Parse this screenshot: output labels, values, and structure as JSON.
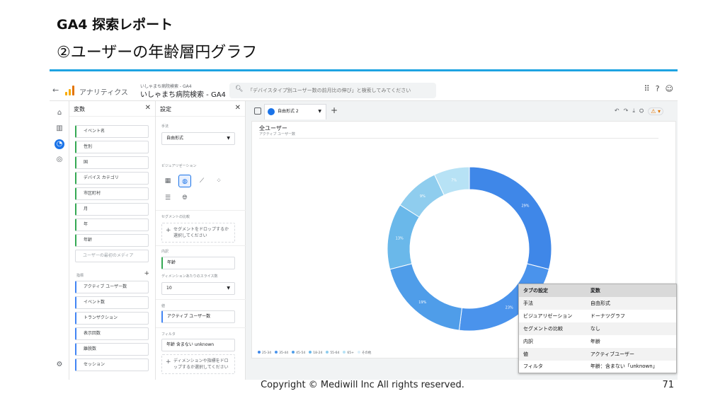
{
  "slide": {
    "title": "GA4 探索レポート",
    "subtitle": "②ユーザーの年齢層円グラフ",
    "footer": "Copyright © Mediwill Inc All rights reserved.",
    "page_number": "71"
  },
  "app": {
    "name": "アナリティクス",
    "account_small": "いしゃまち病院検索 - GA4",
    "account": "いしゃまち病院検索 - GA4",
    "search_placeholder": "「デバイスタイプ別ユーザー数の前月比の伸び」と検索してみてください"
  },
  "variables_panel": {
    "title": "変数",
    "dimensions": [
      "イベント名",
      "性別",
      "国",
      "デバイス カテゴリ",
      "市区町村",
      "月",
      "年",
      "年齢",
      "ユーザーの最初のメディア"
    ],
    "metrics_label": "指標",
    "metrics": [
      "アクティブ ユーザー数",
      "イベント数",
      "トランザクション",
      "表示回数",
      "離脱数",
      "セッション"
    ]
  },
  "settings_panel": {
    "title": "設定",
    "technique_label": "手法",
    "technique_value": "自由形式",
    "visualization_label": "ビジュアリゼーション",
    "segment_label": "セグメントの比較",
    "segment_drop": "セグメントをドロップするか選択してください",
    "breakdown_label": "内訳",
    "breakdown_value": "年齢",
    "rows_label": "ディメンションあたりのスライス数",
    "rows_value": "10",
    "values_label": "値",
    "values_value": "アクティブ ユーザー数",
    "filter_label": "フィルタ",
    "filter_value": "年齢 含まない unknown",
    "filter_drop": "ディメンションや指標をドロップするか選択してください"
  },
  "tab": {
    "label": "自由形式 2"
  },
  "chart_data": {
    "type": "pie",
    "title": "全ユーザー",
    "subtitle": "アクティブ ユーザー数",
    "categories": [
      "25-34",
      "35-44",
      "45-54",
      "18-24",
      "55-64",
      "65+",
      "その他"
    ],
    "values": [
      29,
      23,
      19,
      13,
      9,
      7,
      0
    ],
    "labels": [
      "29%",
      "23%",
      "19%",
      "13%",
      "9%",
      "7%",
      ""
    ],
    "colors": [
      "#3f87e8",
      "#4a93ec",
      "#4f9de9",
      "#6ab8ea",
      "#8fcdee",
      "#b7e2f5",
      "#dbeffa"
    ]
  },
  "tab_settings_table": {
    "headers": [
      "タブの設定",
      "変数"
    ],
    "rows": [
      [
        "手法",
        "自由形式"
      ],
      [
        "ビジュアリゼーション",
        "ドーナツグラフ"
      ],
      [
        "セグメントの比較",
        "なし"
      ],
      [
        "内訳",
        "年齢"
      ],
      [
        "値",
        "アクティブユーザー"
      ],
      [
        "フィルタ",
        "年齢：含まない「unknown」"
      ]
    ]
  }
}
